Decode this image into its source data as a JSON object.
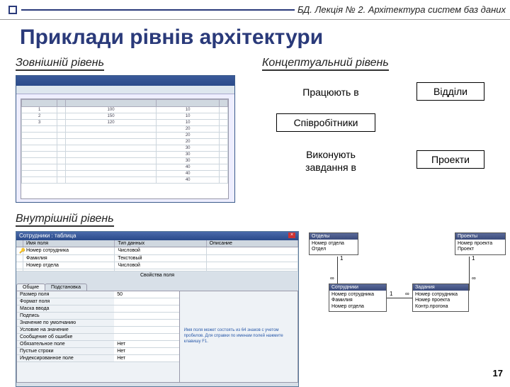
{
  "header": {
    "breadcrumb": "БД. Лекція № 2. Архітектура систем баз даних"
  },
  "title": "Приклади рівнів архітектури",
  "sections": {
    "external": "Зовнішній рівень",
    "conceptual": "Концептуальний рівень",
    "internal": "Внутрішній рівень"
  },
  "diagram": {
    "works_in": "Працюють в",
    "departments": "Відділи",
    "employees": "Співробітники",
    "do_tasks1": "Виконують",
    "do_tasks2": "завдання в",
    "projects": "Проекти"
  },
  "ext_grid": {
    "rows": [
      [
        "1",
        "",
        "100",
        "10"
      ],
      [
        "2",
        "",
        "150",
        "10"
      ],
      [
        "3",
        "",
        "120",
        "10"
      ],
      [
        "",
        "",
        "",
        "20"
      ],
      [
        "",
        "",
        "",
        "20"
      ],
      [
        "",
        "",
        "",
        "20"
      ],
      [
        "",
        "",
        "",
        "30"
      ],
      [
        "",
        "",
        "",
        "30"
      ],
      [
        "",
        "",
        "",
        "30"
      ],
      [
        "",
        "",
        "",
        "40"
      ],
      [
        "",
        "",
        "",
        "40"
      ],
      [
        "",
        "",
        "",
        "40"
      ]
    ]
  },
  "int_win": {
    "title": "Сотрудники : таблица",
    "close": "×",
    "cols": [
      "Имя поля",
      "Тип данных",
      "Описание"
    ],
    "rows": [
      {
        "key": "🔑",
        "c": [
          "Номер сотрудника",
          "Числовой",
          ""
        ]
      },
      {
        "key": "",
        "c": [
          "Фамилия",
          "Текстовый",
          ""
        ]
      },
      {
        "key": "",
        "c": [
          "Номер отдела",
          "Числовой",
          ""
        ]
      }
    ],
    "props_caption": "Свойства поля",
    "tabs": [
      "Общие",
      "Подстановка"
    ],
    "props": [
      [
        "Размер поля",
        "50"
      ],
      [
        "Формат поля",
        ""
      ],
      [
        "Маска ввода",
        ""
      ],
      [
        "Подпись",
        ""
      ],
      [
        "Значение по умолчанию",
        ""
      ],
      [
        "Условие на значение",
        ""
      ],
      [
        "Сообщение об ошибке",
        ""
      ],
      [
        "Обязательное поле",
        "Нет"
      ],
      [
        "Пустые строки",
        "Нет"
      ],
      [
        "Индексированное поле",
        "Нет"
      ]
    ],
    "help": "Имя поля может состоять из 64 знаков с учетом пробелов. Для справки по именам полей нажмите клавишу F1."
  },
  "er": {
    "departments": {
      "title": "Отделы",
      "fields": [
        "Номер отдела",
        "Отдел"
      ]
    },
    "projects": {
      "title": "Проекты",
      "fields": [
        "Номер проекта",
        "Проект"
      ]
    },
    "employees": {
      "title": "Сотрудники",
      "fields": [
        "Номер сотрудника",
        "Фамилия",
        "Номер отдела"
      ]
    },
    "tasks": {
      "title": "Задания",
      "fields": [
        "Номер сотрудника",
        "Номер проекта",
        "Контр.прогона"
      ]
    },
    "card1": "1",
    "cardInf": "∞"
  },
  "page": "17"
}
